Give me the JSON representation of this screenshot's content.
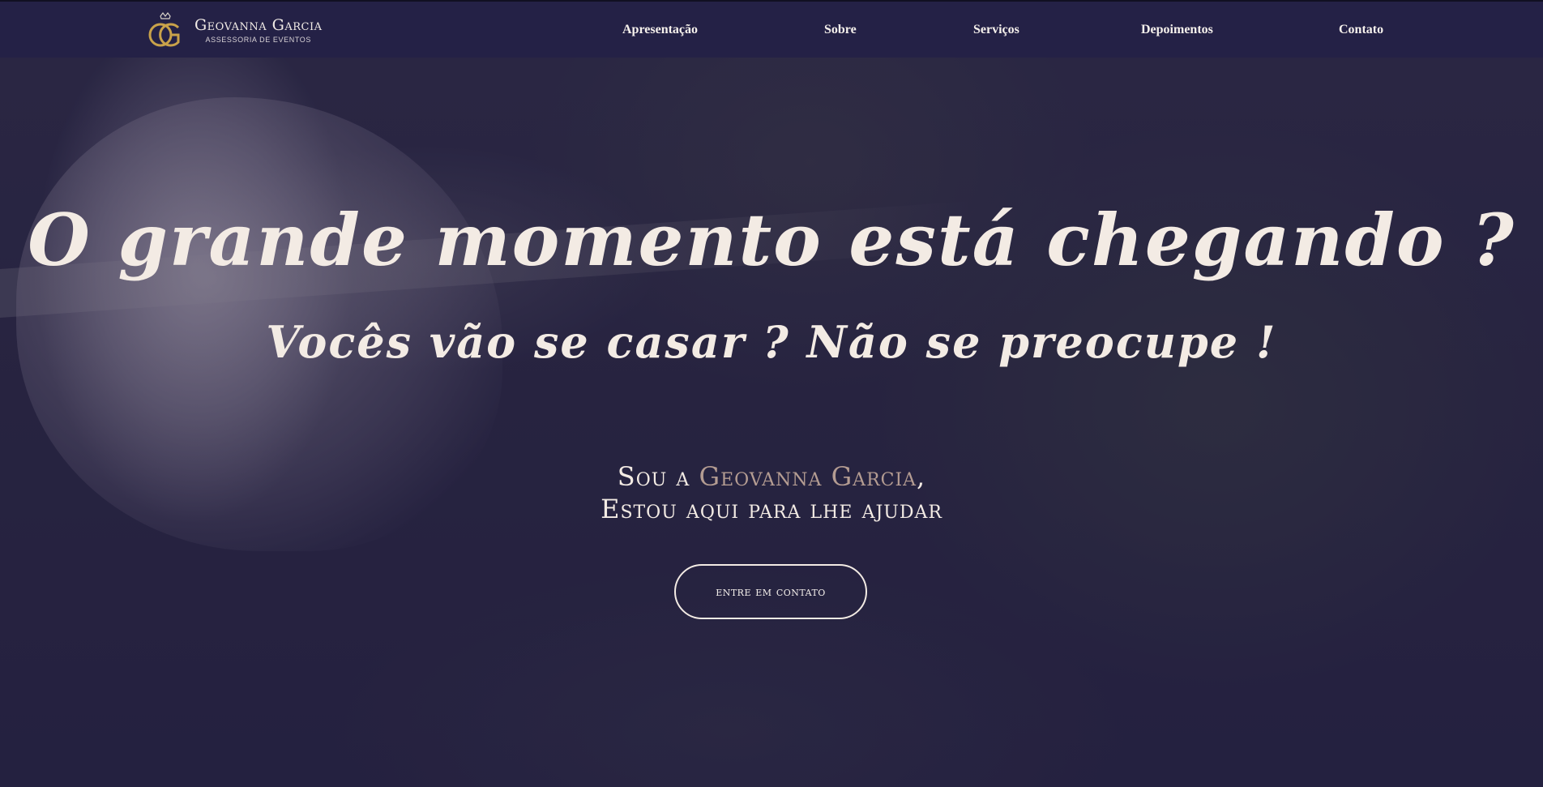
{
  "brand": {
    "name": "Geovanna Garcia",
    "subtitle": "ASSESSORIA DE EVENTOS",
    "logo_icon": "gg-monogram-crown-icon",
    "logo_color": "#c9a24a"
  },
  "nav": {
    "items": [
      {
        "label": "Apresentação"
      },
      {
        "label": "Sobre"
      },
      {
        "label": "Serviços"
      },
      {
        "label": "Depoimentos"
      },
      {
        "label": "Contato"
      }
    ]
  },
  "hero": {
    "headline": "O grande momento está chegando ?",
    "subheadline": "Vocês vão se casar ? Não se preocupe !",
    "intro_prefix": "Sou a ",
    "intro_name": "Geovanna Garcia",
    "intro_suffix": ",",
    "intro_line2": "Estou aqui para lhe ajudar",
    "cta_label": "entre em contato"
  },
  "colors": {
    "navbar": "#242146",
    "overlay": "#231f42",
    "accent_name": "#b49c92",
    "text": "#f3ebe4"
  }
}
